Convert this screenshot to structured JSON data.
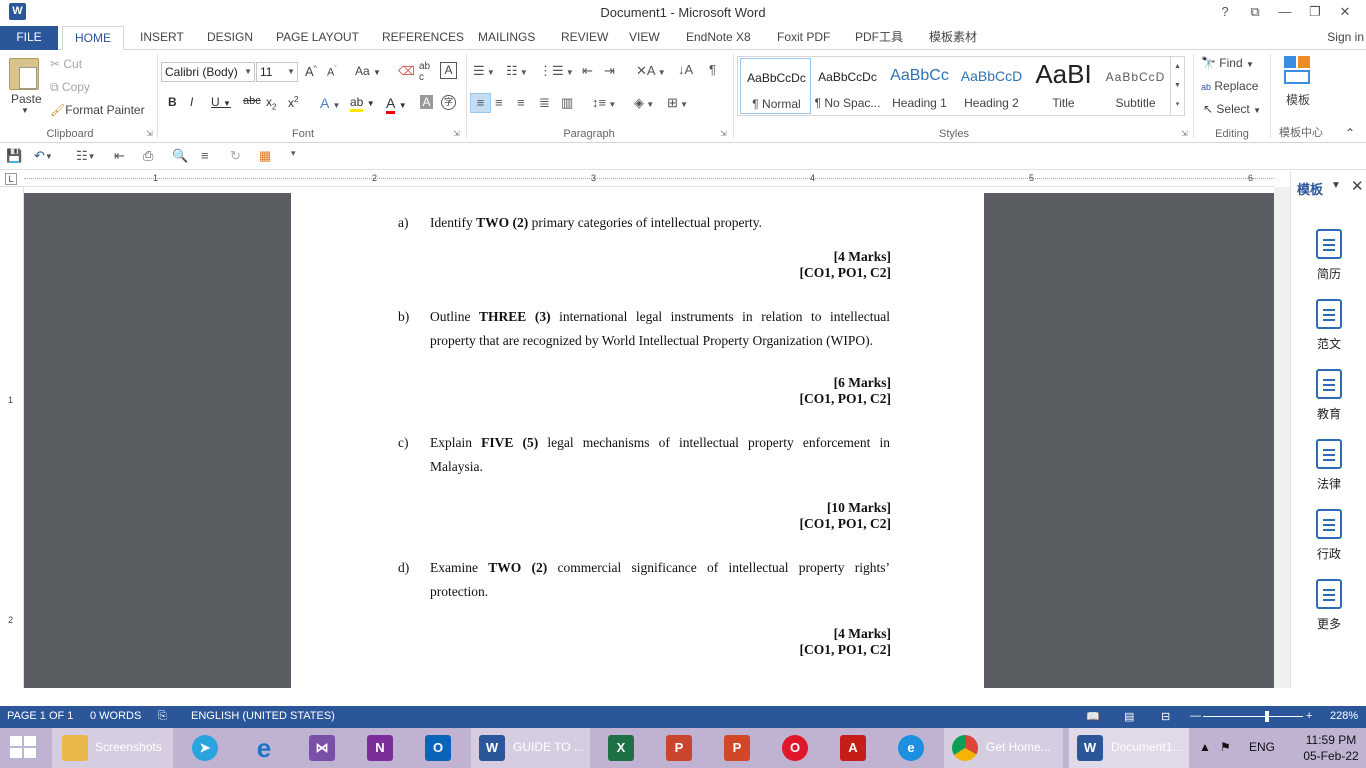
{
  "window": {
    "title": "Document1 - Microsoft Word",
    "app_icon": "W",
    "controls": [
      "?",
      "⧉",
      "—",
      "❐",
      "✕"
    ]
  },
  "tabs": [
    "FILE",
    "HOME",
    "INSERT",
    "DESIGN",
    "PAGE LAYOUT",
    "REFERENCES",
    "MAILINGS",
    "REVIEW",
    "VIEW",
    "EndNote X8",
    "Foxit PDF",
    "PDF工具",
    "模板素材"
  ],
  "signin": "Sign in",
  "ribbon": {
    "clipboard": {
      "paste": "Paste",
      "cut": "Cut",
      "copy": "Copy",
      "format_painter": "Format Painter",
      "label": "Clipboard"
    },
    "font": {
      "name": "Calibri (Body)",
      "size": "11",
      "label": "Font",
      "case": "Aa"
    },
    "paragraph": {
      "label": "Paragraph"
    },
    "styles": {
      "label": "Styles",
      "items": [
        {
          "preview": "AaBbCcDc",
          "name": "¶ Normal"
        },
        {
          "preview": "AaBbCcDc",
          "name": "¶ No Spac..."
        },
        {
          "preview": "AaBbCc",
          "name": "Heading 1"
        },
        {
          "preview": "AaBbCcD",
          "name": "Heading 2"
        },
        {
          "preview": "AaBI",
          "name": "Title"
        },
        {
          "preview": "AaBbCcD",
          "name": "Subtitle"
        }
      ]
    },
    "editing": {
      "find": "Find",
      "replace": "Replace",
      "select": "Select",
      "label": "Editing"
    },
    "template": {
      "name": "模板",
      "label": "模板中心"
    }
  },
  "ruler": {
    "marks": [
      "1",
      "2",
      "3",
      "4",
      "5",
      "6"
    ],
    "corner": "L",
    "vmarks": [
      "1",
      "2"
    ]
  },
  "document": {
    "questions": [
      {
        "letter": "a)",
        "parts": [
          "Identify ",
          "TWO (2)",
          " primary categories of intellectual property."
        ],
        "marks": "[4 Marks]",
        "co": "[CO1, PO1, C2]"
      },
      {
        "letter": "b)",
        "parts": [
          "Outline ",
          "THREE (3)",
          " international legal instruments in relation to intellectual property that are recognized by World Intellectual Property Organization (WIPO)."
        ],
        "marks": "[6 Marks]",
        "co": "[CO1, PO1, C2]"
      },
      {
        "letter": "c)",
        "parts": [
          "Explain ",
          "FIVE (5)",
          " legal mechanisms of intellectual property enforcement in Malaysia."
        ],
        "marks": "[10 Marks]",
        "co": "[CO1, PO1, C2]"
      },
      {
        "letter": "d)",
        "parts": [
          "Examine ",
          "TWO (2)",
          " commercial significance of intellectual property rights’ protection."
        ],
        "marks": "[4 Marks]",
        "co": "[CO1, PO1, C2]"
      }
    ]
  },
  "sidepane": {
    "title": "模板",
    "items": [
      "简历",
      "范文",
      "教育",
      "法律",
      "行政",
      "更多"
    ]
  },
  "status": {
    "page": "PAGE 1 OF 1",
    "words": "0 WORDS",
    "language": "ENGLISH (UNITED STATES)",
    "zoom": "228%",
    "zoom_level": 0.62
  },
  "taskbar": {
    "items": [
      {
        "name": "Screenshots",
        "color": "#e8b84a"
      },
      {
        "name": "telegram",
        "color": "#2aa3de"
      },
      {
        "name": "edge-legacy",
        "color": "#1d75c9"
      },
      {
        "name": "visual-studio",
        "color": "#7a4fa8"
      },
      {
        "name": "onenote",
        "color": "#7b2e9a"
      },
      {
        "name": "outlook",
        "color": "#0a64b8"
      },
      {
        "name": "GUIDE TO ...",
        "color": "#2b579a"
      },
      {
        "name": "excel",
        "color": "#1e7145"
      },
      {
        "name": "powerpoint",
        "color": "#c9452f"
      },
      {
        "name": "powerpoint-2",
        "color": "#d24726"
      },
      {
        "name": "opera",
        "color": "#e0162b"
      },
      {
        "name": "acrobat",
        "color": "#c41e17"
      },
      {
        "name": "edge",
        "color": "#1d8fe0"
      },
      {
        "name": "Get Home...",
        "color": "#3c9b3a"
      },
      {
        "name": "Document1...",
        "color": "#2b579a"
      }
    ],
    "lang": "ENG",
    "time": "11:59 PM",
    "date": "05-Feb-22"
  }
}
